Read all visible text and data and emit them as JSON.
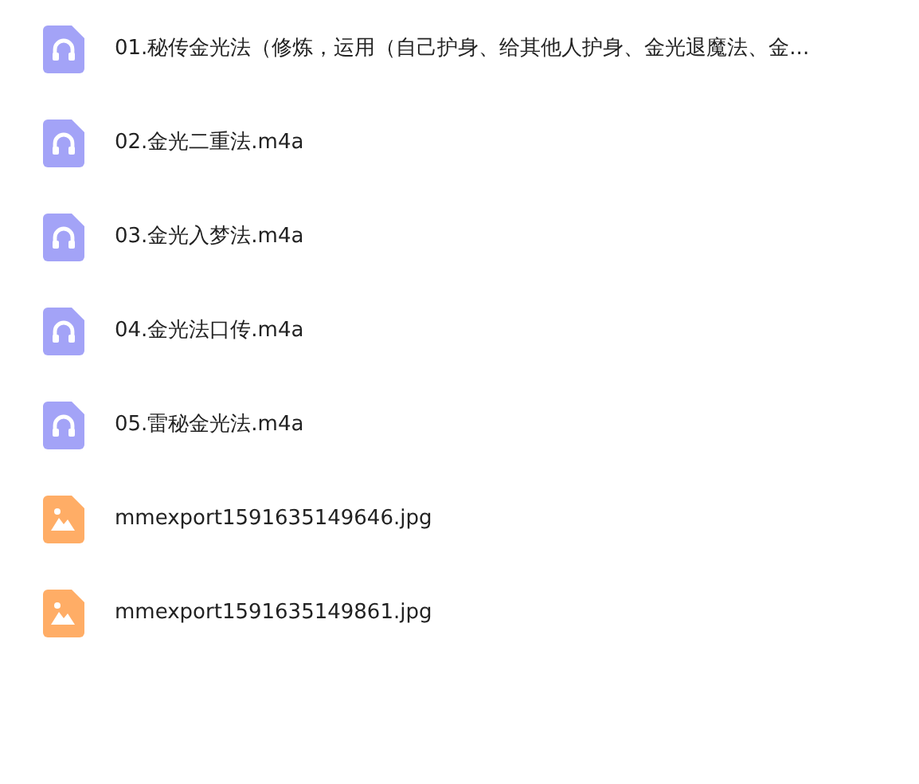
{
  "files": [
    {
      "kind": "audio",
      "name": "01.秘传金光法（修炼，运用（自己护身、给其他人护身、金光退魔法、金..."
    },
    {
      "kind": "audio",
      "name": "02.金光二重法.m4a"
    },
    {
      "kind": "audio",
      "name": "03.金光入梦法.m4a"
    },
    {
      "kind": "audio",
      "name": "04.金光法口传.m4a"
    },
    {
      "kind": "audio",
      "name": "05.雷秘金光法.m4a"
    },
    {
      "kind": "image",
      "name": "mmexport1591635149646.jpg"
    },
    {
      "kind": "image",
      "name": "mmexport1591635149861.jpg"
    }
  ]
}
